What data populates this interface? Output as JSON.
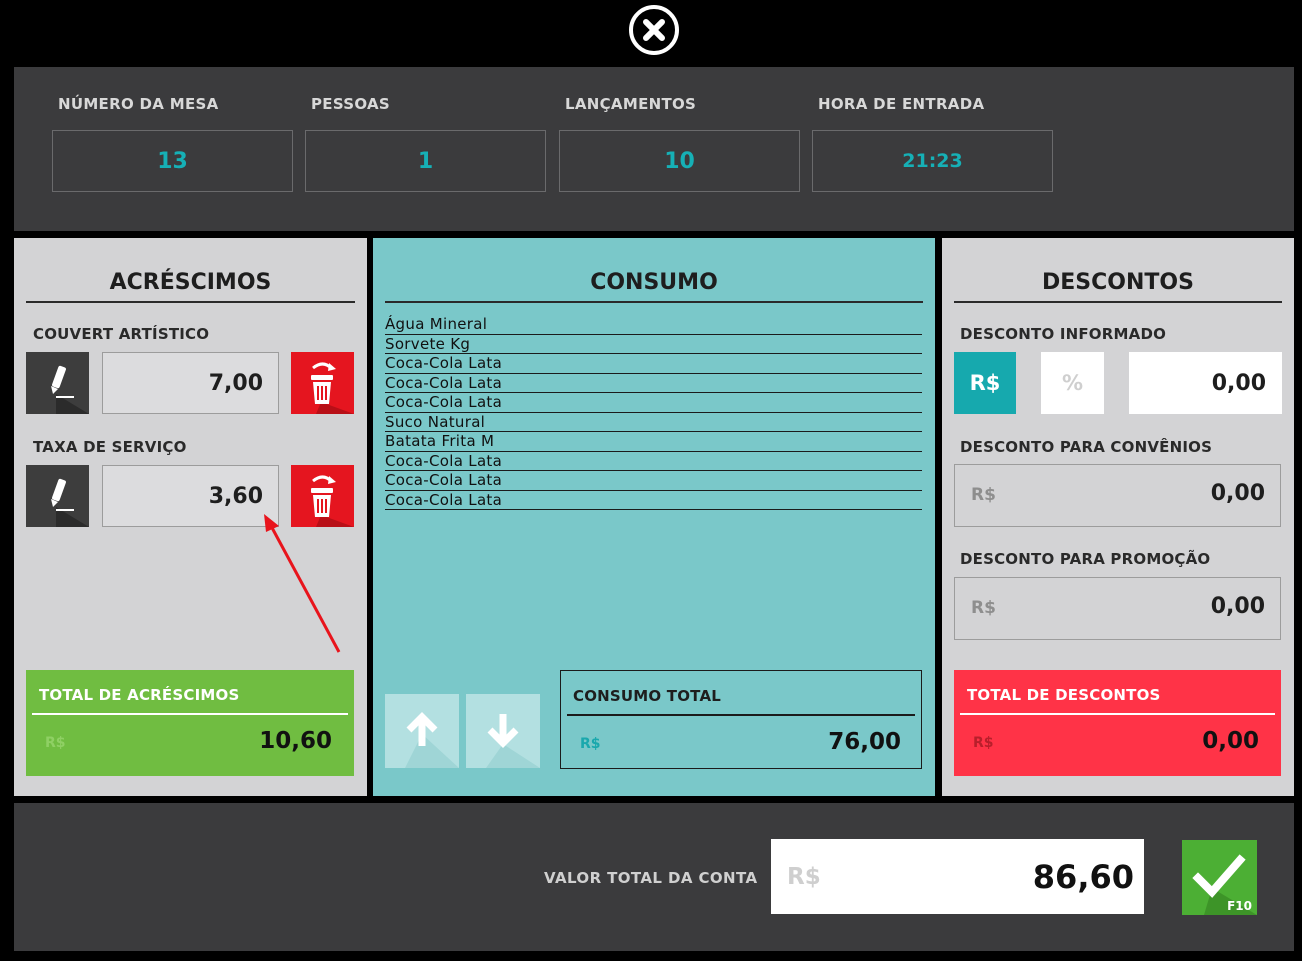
{
  "header": {
    "mesa": {
      "label": "NÚMERO DA MESA",
      "value": "13"
    },
    "pessoas": {
      "label": "PESSOAS",
      "value": "1"
    },
    "lancamentos": {
      "label": "LANÇAMENTOS",
      "value": "10"
    },
    "hora": {
      "label": "HORA DE ENTRADA",
      "value": "21:23"
    }
  },
  "acrescimos": {
    "title": "ACRÉSCIMOS",
    "couvert": {
      "label": "COUVERT ARTÍSTICO",
      "value": "7,00"
    },
    "taxa": {
      "label": "TAXA DE SERVIÇO",
      "value": "3,60"
    },
    "total": {
      "label": "TOTAL DE ACRÉSCIMOS",
      "currency": "R$",
      "value": "10,60"
    }
  },
  "consumo": {
    "title": "CONSUMO",
    "items": [
      "Água Mineral",
      "Sorvete Kg",
      "Coca-Cola Lata",
      "Coca-Cola Lata",
      "Coca-Cola Lata",
      "Suco Natural",
      "Batata Frita M",
      "Coca-Cola Lata",
      "Coca-Cola Lata",
      "Coca-Cola Lata"
    ],
    "total": {
      "label": "CONSUMO TOTAL",
      "currency": "R$",
      "value": "76,00"
    }
  },
  "descontos": {
    "title": "DESCONTOS",
    "informado": {
      "label": "DESCONTO INFORMADO",
      "btn_rs": "R$",
      "btn_pct": "%",
      "value": "0,00"
    },
    "convenios": {
      "label": "DESCONTO PARA CONVÊNIOS",
      "currency": "R$",
      "value": "0,00"
    },
    "promocao": {
      "label": "DESCONTO PARA PROMOÇÃO",
      "currency": "R$",
      "value": "0,00"
    },
    "total": {
      "label": "TOTAL DE DESCONTOS",
      "currency": "R$",
      "value": "0,00"
    }
  },
  "footer": {
    "label": "VALOR TOTAL DA CONTA",
    "currency": "R$",
    "value": "86,60",
    "confirm_key": "F10"
  },
  "icons": {
    "close": "close-icon",
    "edit": "pencil-icon",
    "delete": "trash-icon",
    "up": "arrow-up-icon",
    "down": "arrow-down-icon",
    "confirm": "checkmark-icon"
  },
  "colors": {
    "teal": "#16b0b6",
    "green": "#70bd41",
    "red": "#ff3347",
    "delete_red": "#e5151f",
    "consumo_bg": "#7ac8c9"
  }
}
